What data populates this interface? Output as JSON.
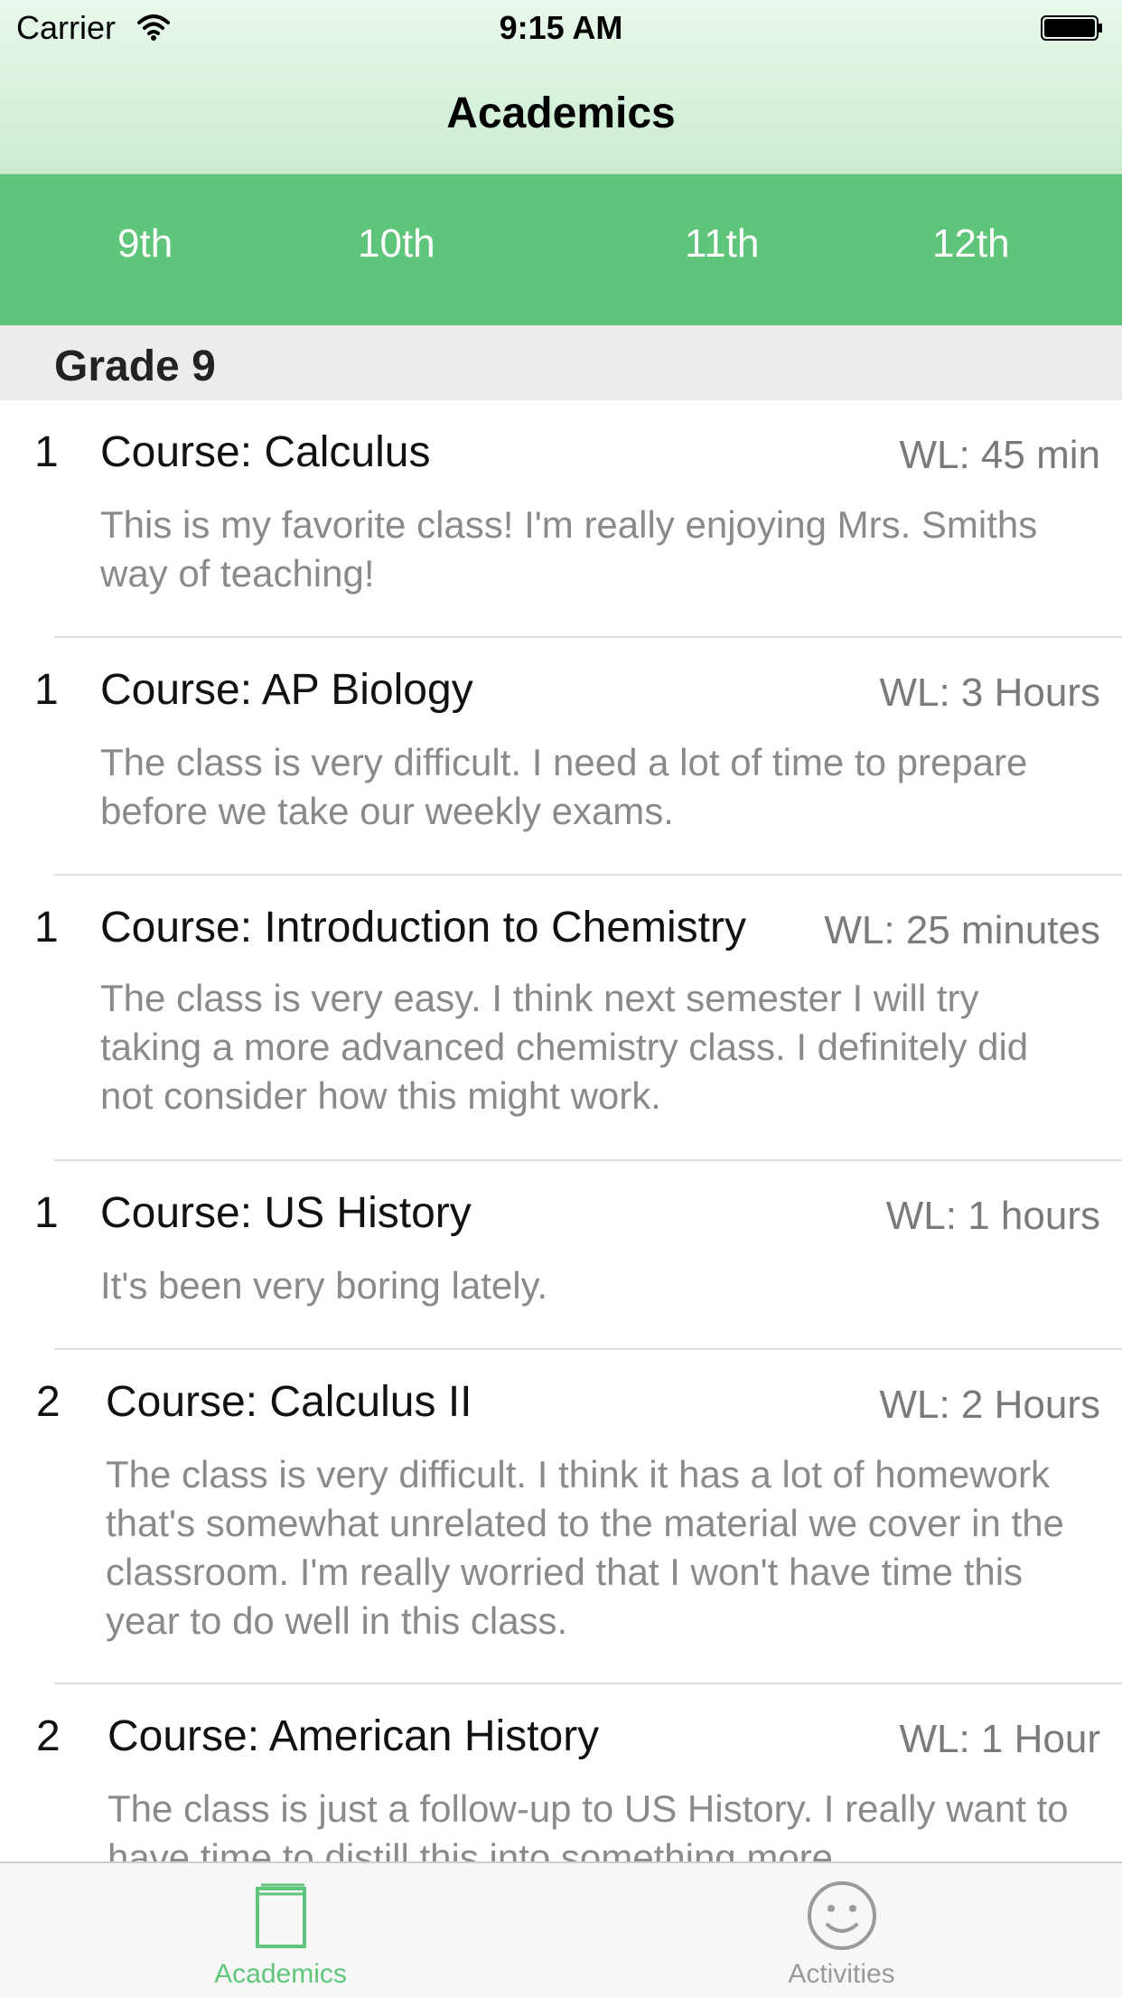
{
  "status_bar": {
    "carrier": "Carrier",
    "time": "9:15 AM"
  },
  "nav": {
    "title": "Academics"
  },
  "grade_tabs": [
    "9th",
    "10th",
    "11th",
    "12th"
  ],
  "section": {
    "title": "Grade 9"
  },
  "courses": [
    {
      "num": "1",
      "course": "Course:  Calculus",
      "wl": "WL:  45 min",
      "comment": "This is my favorite class! I'm really enjoying Mrs. Smiths way of teaching!"
    },
    {
      "num": "1",
      "course": "Course:  AP Biology",
      "wl": "WL:  3 Hours",
      "comment": "The class is very difficult. I need a lot of time to prepare before we take our weekly exams."
    },
    {
      "num": "1",
      "course": "Course:  Introduction to Chemistry",
      "wl": "WL:  25 minutes",
      "comment": "The class is very easy. I think next semester I will try taking a more advanced chemistry class. I definitely did not consider how this might work."
    },
    {
      "num": "1",
      "course": "Course:  US History",
      "wl": "WL:  1 hours",
      "comment": "It's been very boring lately."
    },
    {
      "num": "2",
      "course": "Course:  Calculus II",
      "wl": "WL:  2 Hours",
      "comment": "The class is very difficult. I think it has a lot of homework that's somewhat unrelated to the material we cover in the classroom. I'm really worried that I won't have time this year to do well in this class."
    },
    {
      "num": "2",
      "course": "Course:  American History",
      "wl": "WL:  1 Hour",
      "comment": "The class is just a follow-up to US History. I really want to have time to distill this into something more"
    }
  ],
  "tabbar": {
    "items": [
      {
        "label": "Academics",
        "icon": "book-icon",
        "selected": true
      },
      {
        "label": "Activities",
        "icon": "smiley-icon",
        "selected": false
      }
    ],
    "active_color": "#5fc57a",
    "inactive_color": "#9a9a9a"
  },
  "colors": {
    "accent": "#5fc57a",
    "header_bg": "#d8f2dc"
  }
}
